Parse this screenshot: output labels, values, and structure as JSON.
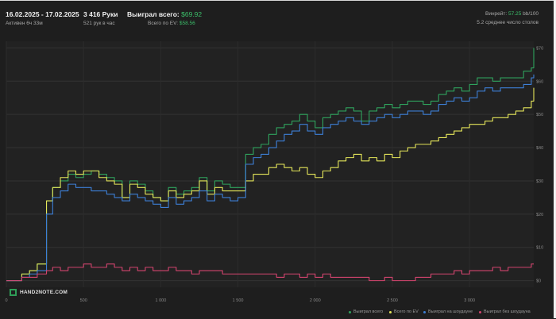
{
  "header": {
    "date_range": "16.02.2025 - 17.02.2025",
    "active_time": "Активен 6ч 33м",
    "hands": "3 416 Руки",
    "hands_rate": "521 рук в час",
    "won_label": "Выиграл всего:",
    "won_value": "$69.92",
    "ev_label": "Всего по EV:",
    "ev_value": "$58.56",
    "winrate_label": "Винрейт:",
    "winrate_value": "57.25",
    "winrate_suffix": "bb/100",
    "avg_tables": "5.2 среднее число столов"
  },
  "logo": {
    "text": "HAND2NOTE.COM"
  },
  "legend": [
    {
      "label": "Выиграл всего",
      "color": "#2fa35d"
    },
    {
      "label": "Всего по EV",
      "color": "#e5e65a"
    },
    {
      "label": "Выиграл на шоудауне",
      "color": "#3d7fd6"
    },
    {
      "label": "Выиграл без шоудауна",
      "color": "#d4446f"
    }
  ],
  "chart_data": {
    "type": "line",
    "xlim": [
      0,
      3416
    ],
    "ylim": [
      -2,
      72
    ],
    "x_ticks": [
      0,
      500,
      1000,
      1500,
      2000,
      2500,
      3000
    ],
    "x_tick_labels": [
      "0",
      "500",
      "1 000",
      "1 500",
      "2 000",
      "2 500",
      "3 000"
    ],
    "y_ticks": [
      0,
      10,
      20,
      30,
      40,
      50,
      60,
      70
    ],
    "y_tick_labels": [
      "$0",
      "$10",
      "$20",
      "$30",
      "$40",
      "$50",
      "$60",
      "$70"
    ],
    "grid": true,
    "legend_position": "bottom-right",
    "x": [
      0,
      100,
      150,
      200,
      260,
      300,
      350,
      400,
      450,
      500,
      550,
      600,
      650,
      700,
      750,
      800,
      850,
      900,
      950,
      1000,
      1050,
      1100,
      1150,
      1200,
      1250,
      1300,
      1350,
      1400,
      1450,
      1500,
      1550,
      1600,
      1650,
      1700,
      1750,
      1800,
      1850,
      1900,
      1950,
      2000,
      2050,
      2100,
      2150,
      2200,
      2250,
      2300,
      2350,
      2400,
      2450,
      2500,
      2550,
      2600,
      2650,
      2700,
      2750,
      2800,
      2850,
      2900,
      2950,
      3000,
      3050,
      3100,
      3150,
      3200,
      3250,
      3300,
      3350,
      3400,
      3416
    ],
    "series": [
      {
        "name": "Выиграл всего",
        "color": "#2fa35d",
        "values": [
          0,
          2,
          3,
          5,
          24,
          28,
          30,
          32,
          31,
          32,
          33,
          32,
          31,
          30,
          25,
          30,
          29,
          27,
          25,
          24,
          28,
          26,
          27,
          28,
          31,
          27,
          30,
          29,
          28,
          28,
          38,
          40,
          41,
          44,
          46,
          47,
          48,
          50,
          48,
          46,
          49,
          50,
          51,
          52,
          51,
          48,
          51,
          52,
          53,
          52,
          53,
          54,
          54,
          53,
          54,
          56,
          57,
          58,
          57,
          59,
          61,
          61,
          60,
          61,
          61,
          61,
          63,
          64,
          70
        ]
      },
      {
        "name": "Всего по EV",
        "color": "#e5e65a",
        "values": [
          0,
          2,
          3,
          5,
          24,
          28,
          31,
          33,
          32,
          33,
          33,
          31,
          30,
          29,
          25,
          29,
          28,
          26,
          25,
          24,
          27,
          25,
          26,
          27,
          30,
          26,
          28,
          27,
          27,
          27,
          30,
          32,
          32,
          34,
          35,
          34,
          33,
          34,
          32,
          31,
          33,
          34,
          36,
          37,
          38,
          36,
          37,
          36,
          38,
          37,
          39,
          40,
          41,
          41,
          42,
          43,
          44,
          45,
          46,
          47,
          47,
          48,
          49,
          49,
          50,
          51,
          52,
          54,
          58
        ]
      },
      {
        "name": "Выиграл на шоудауне",
        "color": "#3d7fd6",
        "values": [
          0,
          1,
          2,
          3,
          20,
          25,
          27,
          29,
          28,
          28,
          27,
          27,
          26,
          25,
          24,
          26,
          25,
          24,
          23,
          22,
          25,
          23,
          24,
          25,
          27,
          24,
          26,
          25,
          24,
          25,
          35,
          37,
          38,
          40,
          42,
          44,
          45,
          47,
          45,
          44,
          46,
          47,
          48,
          49,
          48,
          47,
          48,
          49,
          50,
          49,
          50,
          51,
          51,
          50,
          51,
          53,
          54,
          55,
          54,
          55,
          57,
          58,
          57,
          58,
          58,
          58,
          59,
          61,
          62
        ]
      },
      {
        "name": "Выиграл без шоудауна",
        "color": "#d4446f",
        "values": [
          0,
          1,
          1,
          2,
          3,
          4,
          3,
          4,
          4,
          5,
          4,
          4,
          5,
          4,
          3,
          4,
          3,
          4,
          3,
          3,
          4,
          3,
          3,
          2,
          3,
          3,
          3,
          2,
          2,
          2,
          2,
          2,
          2,
          2,
          1,
          2,
          2,
          1,
          2,
          1,
          2,
          1,
          1,
          1,
          1,
          1,
          0,
          0,
          1,
          0,
          0,
          0,
          1,
          1,
          2,
          2,
          2,
          3,
          2,
          3,
          3,
          3,
          4,
          3,
          4,
          4,
          4,
          5,
          5
        ]
      }
    ]
  }
}
